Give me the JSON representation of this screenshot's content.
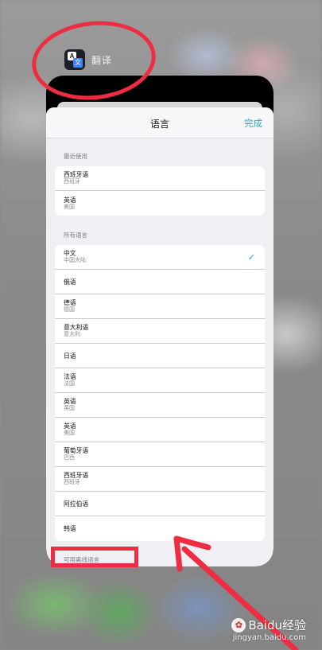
{
  "app": {
    "icon_name": "translate-app-icon",
    "name": "翻译"
  },
  "navbar": {
    "title": "语言",
    "done_label": "完成"
  },
  "recent": {
    "header": "最近使用",
    "items": [
      {
        "name": "西班牙语",
        "sub": "西班牙"
      },
      {
        "name": "英语",
        "sub": "美国"
      }
    ]
  },
  "all_languages": {
    "header": "所有语言",
    "items": [
      {
        "name": "中文",
        "sub": "中国大陆",
        "selected": true
      },
      {
        "name": "俄语",
        "sub": ""
      },
      {
        "name": "德语",
        "sub": "德国"
      },
      {
        "name": "意大利语",
        "sub": "意大利"
      },
      {
        "name": "日语",
        "sub": ""
      },
      {
        "name": "法语",
        "sub": "法国"
      },
      {
        "name": "英语",
        "sub": "英国"
      },
      {
        "name": "英语",
        "sub": "美国"
      },
      {
        "name": "葡萄牙语",
        "sub": "巴西"
      },
      {
        "name": "西班牙语",
        "sub": "西班牙"
      },
      {
        "name": "阿拉伯语",
        "sub": ""
      },
      {
        "name": "韩语",
        "sub": ""
      }
    ]
  },
  "footer": {
    "label": "可用离线语言"
  },
  "watermark": {
    "brand": "Baidu经验",
    "url": "jingyan.baidu.com"
  },
  "colors": {
    "accent": "#1ab0c6",
    "annotation": "#ee2d42"
  }
}
